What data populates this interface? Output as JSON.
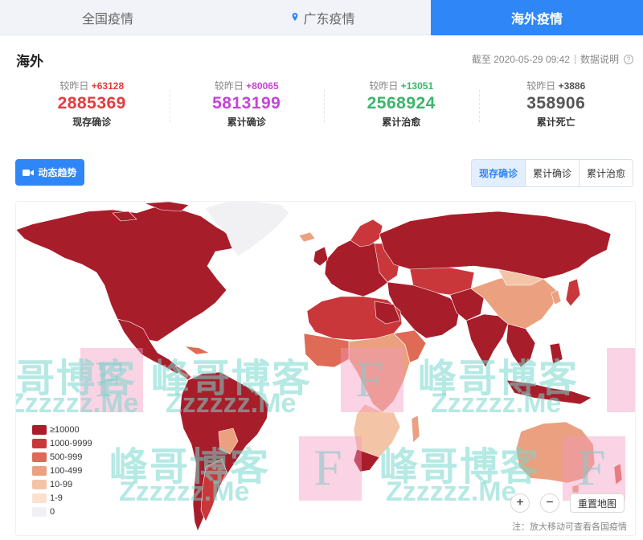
{
  "tabs": [
    {
      "label": "全国疫情"
    },
    {
      "label": "广东疫情"
    },
    {
      "label": "海外疫情"
    }
  ],
  "header": {
    "title": "海外",
    "cutoff": "截至 2020-05-29 09:42",
    "explain": "数据说明"
  },
  "stats": [
    {
      "delta_label": "较昨日",
      "delta": "+63128",
      "value": "2885369",
      "label": "现存确诊",
      "color": "#e8393c"
    },
    {
      "delta_label": "较昨日",
      "delta": "+80065",
      "value": "5813199",
      "label": "累计确诊",
      "color": "#c544d9"
    },
    {
      "delta_label": "较昨日",
      "delta": "+13051",
      "value": "2568924",
      "label": "累计治愈",
      "color": "#3bb56a"
    },
    {
      "delta_label": "较昨日",
      "delta": "+3886",
      "value": "358906",
      "label": "累计死亡",
      "color": "#555555"
    }
  ],
  "controls": {
    "trend_button": "动态趋势",
    "segments": [
      "现存确诊",
      "累计确诊",
      "累计治愈"
    ],
    "active_segment": "现存确诊"
  },
  "map": {
    "legend": [
      {
        "label": "≥10000",
        "color": "#a81d2a"
      },
      {
        "label": "1000-9999",
        "color": "#c9373a"
      },
      {
        "label": "500-999",
        "color": "#df6a55"
      },
      {
        "label": "100-499",
        "color": "#eba07f"
      },
      {
        "label": "10-99",
        "color": "#f4c4a7"
      },
      {
        "label": "1-9",
        "color": "#f9e2cf"
      },
      {
        "label": "0",
        "color": "#f1f1f3"
      }
    ],
    "zoom_in": "+",
    "zoom_out": "−",
    "reset": "重置地图",
    "note": "注：放大移动可查看各国疫情"
  },
  "watermark": {
    "cn": "峰哥博客",
    "en": "Zzzzzz.Me",
    "letter": "F"
  }
}
